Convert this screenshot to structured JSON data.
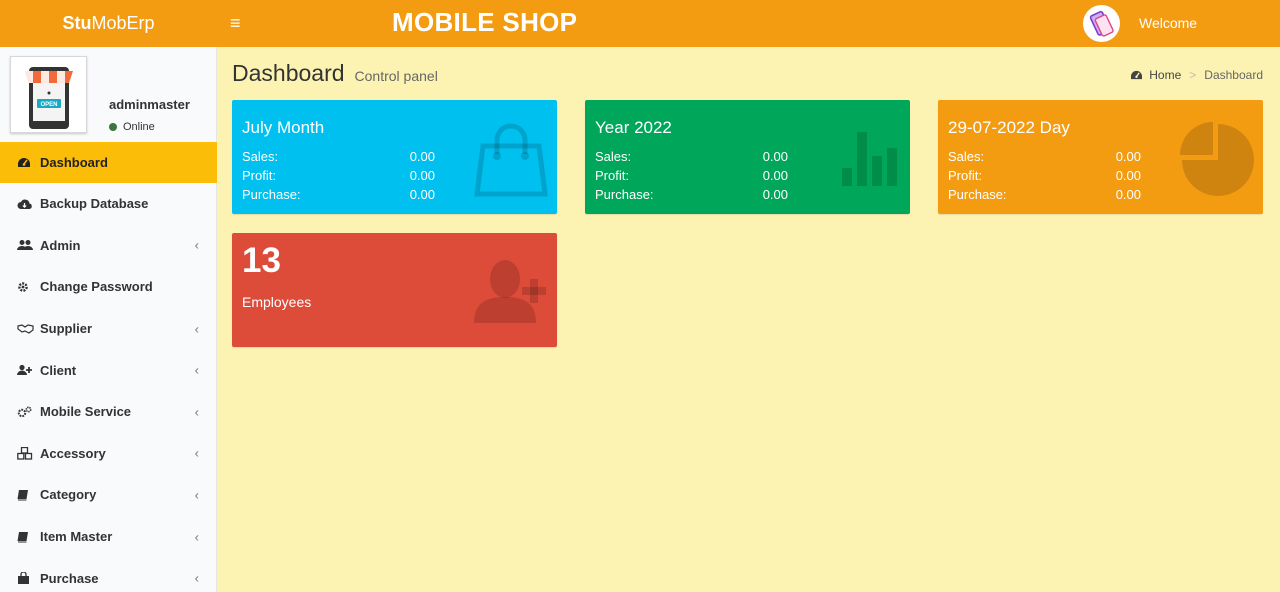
{
  "header": {
    "logo_bold": "Stu",
    "logo_rest": "MobErp",
    "menu_toggle": "≡",
    "shop_title": "MOBILE SHOP",
    "welcome": "Welcome"
  },
  "user": {
    "name": "adminmaster",
    "status": "Online",
    "avatar_sign": "OPEN"
  },
  "sidebar": {
    "items": [
      {
        "label": "Dashboard",
        "icon": "dashboard-icon",
        "active": true,
        "has_caret": false
      },
      {
        "label": "Backup Database",
        "icon": "cloud-download-icon",
        "has_caret": false
      },
      {
        "label": "Admin",
        "icon": "users-icon",
        "has_caret": true
      },
      {
        "label": "Change Password",
        "icon": "gear-icon",
        "has_caret": false
      },
      {
        "label": "Supplier",
        "icon": "handshake-icon",
        "has_caret": true
      },
      {
        "label": "Client",
        "icon": "user-plus-icon",
        "has_caret": true
      },
      {
        "label": "Mobile Service",
        "icon": "cogs-icon",
        "has_caret": true
      },
      {
        "label": "Accessory",
        "icon": "cubes-icon",
        "has_caret": true
      },
      {
        "label": "Category",
        "icon": "book-icon",
        "has_caret": true
      },
      {
        "label": "Item Master",
        "icon": "book-icon",
        "has_caret": true
      },
      {
        "label": "Purchase",
        "icon": "shopping-bag-icon",
        "has_caret": true
      }
    ],
    "caret": "‹"
  },
  "page": {
    "title": "Dashboard",
    "subtitle": "Control panel"
  },
  "breadcrumb": {
    "home": "Home",
    "separator": ">",
    "current": "Dashboard"
  },
  "stats": {
    "month": {
      "title": "July Month",
      "sales_label": "Sales:",
      "sales": "0.00",
      "profit_label": "Profit:",
      "profit": "0.00",
      "purchase_label": "Purchase:",
      "purchase": "0.00"
    },
    "year": {
      "title": "Year 2022",
      "sales_label": "Sales:",
      "sales": "0.00",
      "profit_label": "Profit:",
      "profit": "0.00",
      "purchase_label": "Purchase:",
      "purchase": "0.00"
    },
    "day": {
      "title": "29-07-2022 Day",
      "sales_label": "Sales:",
      "sales": "0.00",
      "profit_label": "Profit:",
      "profit": "0.00",
      "purchase_label": "Purchase:",
      "purchase": "0.00"
    },
    "employees": {
      "count": "13",
      "label": "Employees"
    }
  },
  "colors": {
    "header": "#f39c12",
    "content_bg": "#fcf3b3",
    "active_menu": "#fbbd08",
    "aqua": "#00c0ef",
    "green": "#00a65a",
    "orange": "#f39c12",
    "red": "#dd4b39"
  }
}
